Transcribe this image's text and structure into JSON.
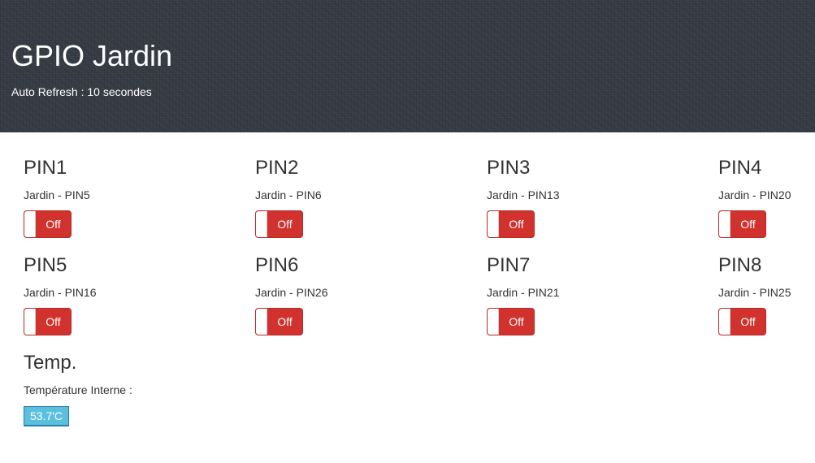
{
  "header": {
    "title": "GPIO Jardin",
    "subtitle": "Auto Refresh : 10 secondes"
  },
  "pins": [
    {
      "name": "PIN1",
      "label": "Jardin - PIN5",
      "state": "Off"
    },
    {
      "name": "PIN2",
      "label": "Jardin - PIN6",
      "state": "Off"
    },
    {
      "name": "PIN3",
      "label": "Jardin - PIN13",
      "state": "Off"
    },
    {
      "name": "PIN4",
      "label": "Jardin - PIN20",
      "state": "Off"
    },
    {
      "name": "PIN5",
      "label": "Jardin - PIN16",
      "state": "Off"
    },
    {
      "name": "PIN6",
      "label": "Jardin - PIN26",
      "state": "Off"
    },
    {
      "name": "PIN7",
      "label": "Jardin - PIN21",
      "state": "Off"
    },
    {
      "name": "PIN8",
      "label": "Jardin - PIN25",
      "state": "Off"
    }
  ],
  "temp": {
    "title": "Temp.",
    "label": "Température Interne :",
    "value": "53.7'C"
  },
  "colors": {
    "header_bg": "#353a43",
    "toggle_off": "#d2322d",
    "temp_badge": "#5bc0de"
  }
}
